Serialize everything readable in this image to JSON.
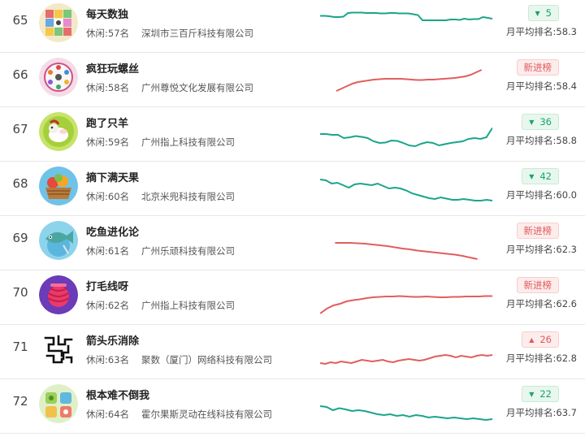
{
  "colors": {
    "down": "#1aa26f",
    "up": "#e05a5a",
    "trend_green": "#19a58a",
    "trend_red": "#e35d5d"
  },
  "rows": [
    {
      "rank": "65",
      "name": "每天数独",
      "category": "休闲:57名",
      "company": "深圳市三百斤科技有限公司",
      "change": {
        "type": "down",
        "icon": "triangle-down-icon",
        "text": "5"
      },
      "avg": "月平均排名:58.3",
      "trend": [
        0.27,
        0.27,
        0.28,
        0.3,
        0.3,
        0.29,
        0.2,
        0.19,
        0.19,
        0.19,
        0.2,
        0.2,
        0.2,
        0.21,
        0.21,
        0.2,
        0.2,
        0.21,
        0.21,
        0.21,
        0.23,
        0.25,
        0.38,
        0.38,
        0.38,
        0.38,
        0.38,
        0.38,
        0.36,
        0.36,
        0.37,
        0.34,
        0.36,
        0.35,
        0.35,
        0.3,
        0.32,
        0.34
      ]
    },
    {
      "rank": "66",
      "name": "疯狂玩螺丝",
      "category": "休闲:58名",
      "company": "广州尊悦文化发展有限公司",
      "change": {
        "type": "new",
        "icon": "",
        "text": "新进榜"
      },
      "avg": "月平均排名:58.4",
      "trend": [
        null,
        null,
        null,
        0.78,
        0.72,
        0.66,
        0.6,
        0.56,
        0.54,
        0.52,
        0.5,
        0.49,
        0.48,
        0.48,
        0.48,
        0.48,
        0.49,
        0.5,
        0.51,
        0.51,
        0.5,
        0.5,
        0.49,
        0.48,
        0.47,
        0.46,
        0.44,
        0.42,
        0.38,
        0.32,
        0.26,
        null,
        null
      ]
    },
    {
      "rank": "67",
      "name": "跑了只羊",
      "category": "休闲:59名",
      "company": "广州指上科技有限公司",
      "change": {
        "type": "down",
        "icon": "triangle-down-icon",
        "text": "36"
      },
      "avg": "月平均排名:58.8",
      "trend": [
        0.5,
        0.5,
        0.52,
        0.52,
        0.6,
        0.58,
        0.55,
        0.57,
        0.6,
        0.68,
        0.72,
        0.71,
        0.66,
        0.67,
        0.72,
        0.78,
        0.8,
        0.74,
        0.7,
        0.72,
        0.78,
        0.75,
        0.72,
        0.7,
        0.68,
        0.62,
        0.6,
        0.62,
        0.58,
        0.35
      ]
    },
    {
      "rank": "68",
      "name": "摘下满天果",
      "category": "休闲:60名",
      "company": "北京米兜科技有限公司",
      "change": {
        "type": "down",
        "icon": "triangle-down-icon",
        "text": "42"
      },
      "avg": "月平均排名:60.0",
      "trend": [
        0.28,
        0.3,
        0.38,
        0.36,
        0.42,
        0.48,
        0.4,
        0.38,
        0.4,
        0.42,
        0.38,
        0.44,
        0.5,
        0.48,
        0.5,
        0.55,
        0.62,
        0.66,
        0.7,
        0.74,
        0.76,
        0.72,
        0.75,
        0.78,
        0.78,
        0.76,
        0.78,
        0.8,
        0.8,
        0.78,
        0.8
      ]
    },
    {
      "rank": "69",
      "name": "吃鱼进化论",
      "category": "休闲:61名",
      "company": "广州乐顽科技有限公司",
      "change": {
        "type": "new",
        "icon": "",
        "text": "新进榜"
      },
      "avg": "月平均排名:62.3",
      "trend": [
        null,
        null,
        0.5,
        0.5,
        0.5,
        0.51,
        0.52,
        0.54,
        0.56,
        0.58,
        0.61,
        0.64,
        0.66,
        0.69,
        0.71,
        0.73,
        0.75,
        0.77,
        0.79,
        0.82,
        0.86,
        0.9,
        null,
        null
      ]
    },
    {
      "rank": "70",
      "name": "打毛线呀",
      "category": "休闲:62名",
      "company": "广州指上科技有限公司",
      "change": {
        "type": "new",
        "icon": "",
        "text": "新进榜"
      },
      "avg": "月平均排名:62.6",
      "trend": [
        0.9,
        0.78,
        0.7,
        0.66,
        0.6,
        0.57,
        0.55,
        0.52,
        0.5,
        0.49,
        0.48,
        0.48,
        0.47,
        0.48,
        0.49,
        0.49,
        0.48,
        0.49,
        0.5,
        0.5,
        0.49,
        0.49,
        0.48,
        0.48,
        0.48,
        0.47,
        0.47
      ]
    },
    {
      "rank": "71",
      "name": "箭头乐消除",
      "category": "休闲:63名",
      "company": "聚数（厦门）网络科技有限公司",
      "change": {
        "type": "up",
        "icon": "triangle-up-icon",
        "text": "26"
      },
      "avg": "月平均排名:62.8",
      "trend": [
        0.78,
        0.8,
        0.76,
        0.78,
        0.74,
        0.76,
        0.78,
        0.74,
        0.7,
        0.72,
        0.74,
        0.72,
        0.7,
        0.74,
        0.76,
        0.72,
        0.7,
        0.68,
        0.7,
        0.72,
        0.7,
        0.66,
        0.62,
        0.6,
        0.58,
        0.6,
        0.64,
        0.6,
        0.62,
        0.64,
        0.6,
        0.58,
        0.6,
        0.58
      ]
    },
    {
      "rank": "72",
      "name": "根本难不倒我",
      "category": "休闲:64名",
      "company": "霍尔果斯灵动在线科技有限公司",
      "change": {
        "type": "down",
        "icon": "triangle-down-icon",
        "text": "22"
      },
      "avg": "月平均排名:63.7",
      "trend": [
        0.5,
        0.52,
        0.6,
        0.55,
        0.58,
        0.62,
        0.6,
        0.62,
        0.66,
        0.7,
        0.72,
        0.7,
        0.74,
        0.72,
        0.76,
        0.72,
        0.74,
        0.78,
        0.76,
        0.78,
        0.8,
        0.78,
        0.8,
        0.82,
        0.8,
        0.82,
        0.84,
        0.82
      ]
    }
  ]
}
